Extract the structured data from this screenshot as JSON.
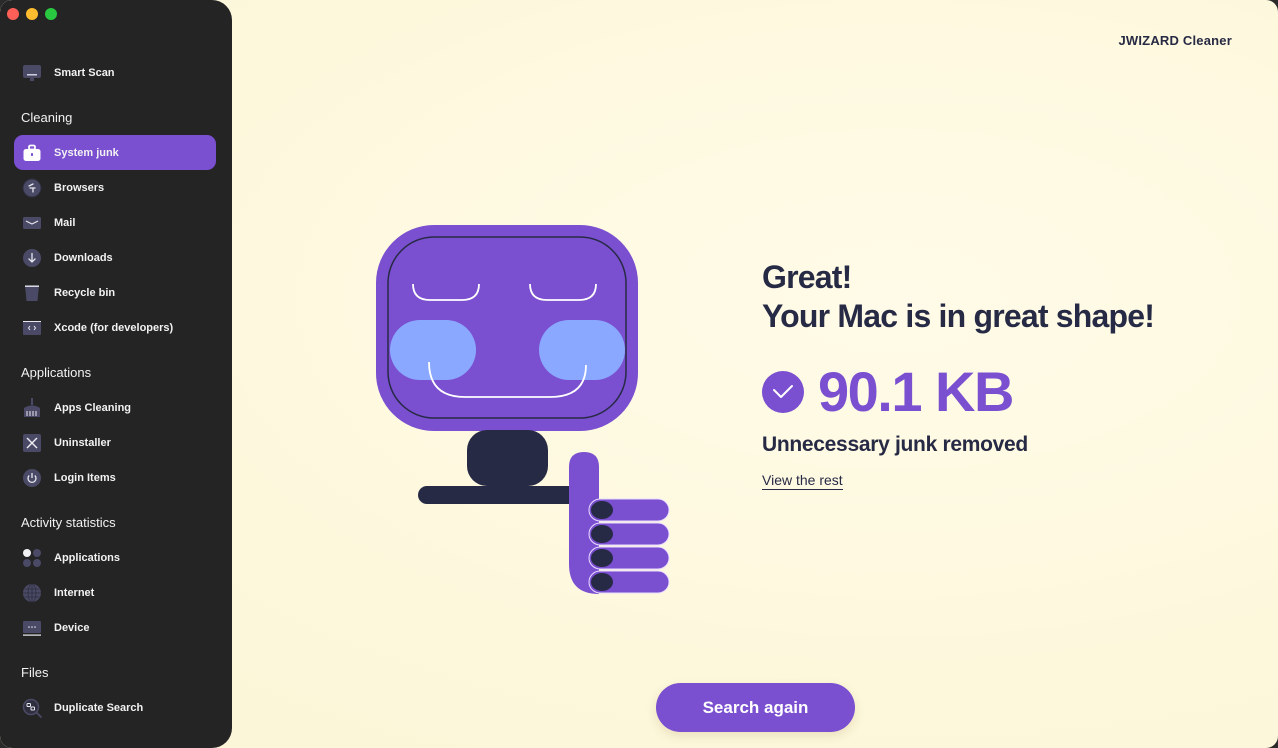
{
  "window": {
    "controls": [
      "close",
      "minimize",
      "zoom"
    ]
  },
  "brand": "JWIZARD Cleaner",
  "sidebar": {
    "top_item": {
      "label": "Smart Scan",
      "icon": "monitor-icon"
    },
    "sections": [
      {
        "title": "Cleaning",
        "items": [
          {
            "label": "System junk",
            "icon": "briefcase-icon",
            "active": true
          },
          {
            "label": "Browsers",
            "icon": "compass-icon"
          },
          {
            "label": "Mail",
            "icon": "envelope-icon"
          },
          {
            "label": "Downloads",
            "icon": "download-arrow-icon"
          },
          {
            "label": "Recycle bin",
            "icon": "trash-icon"
          },
          {
            "label": "Xcode (for developers)",
            "icon": "code-icon"
          }
        ]
      },
      {
        "title": "Applications",
        "items": [
          {
            "label": "Apps Cleaning",
            "icon": "broom-icon"
          },
          {
            "label": "Uninstaller",
            "icon": "x-box-icon"
          },
          {
            "label": "Login Items",
            "icon": "power-icon"
          }
        ]
      },
      {
        "title": "Activity statistics",
        "items": [
          {
            "label": "Applications",
            "icon": "dots-grid-icon"
          },
          {
            "label": "Internet",
            "icon": "globe-icon"
          },
          {
            "label": "Device",
            "icon": "device-icon"
          }
        ]
      },
      {
        "title": "Files",
        "items": [
          {
            "label": "Duplicate Search",
            "icon": "duplicate-search-icon"
          }
        ]
      }
    ]
  },
  "result": {
    "headline_line1": "Great!",
    "headline_line2": "Your Mac is in great shape!",
    "size_value": "90.1 KB",
    "subtitle": "Unnecessary junk removed",
    "view_link": "View the rest"
  },
  "actions": {
    "search_again": "Search again"
  },
  "colors": {
    "accent": "#7a4fd0",
    "sidebar_bg": "#242424",
    "text_dark": "#272a44",
    "background": "#fdf8dc",
    "cheek": "#8aa8ff"
  }
}
